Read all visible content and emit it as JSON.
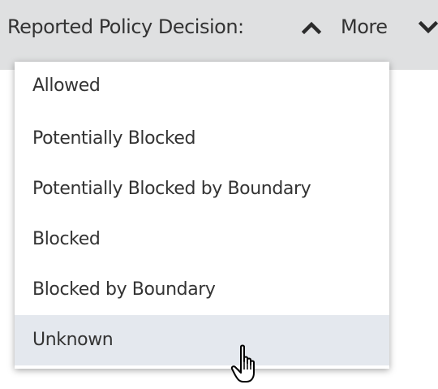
{
  "filter_bar": {
    "label": "Reported Policy Decision:",
    "collapse_icon": "chevron-up-icon",
    "more_label": "More",
    "more_icon": "chevron-down-icon"
  },
  "dropdown": {
    "options": [
      {
        "label": "Allowed"
      },
      {
        "label": "Potentially Blocked"
      },
      {
        "label": "Potentially Blocked by Boundary"
      },
      {
        "label": "Blocked"
      },
      {
        "label": "Blocked by Boundary"
      },
      {
        "label": "Unknown"
      }
    ],
    "hovered_option": "Unknown"
  },
  "cursor": {
    "icon": "hand-pointer-icon"
  },
  "colors": {
    "bar_background": "#dfe0e1",
    "text": "#333333",
    "hover_background": "#e4e8ee"
  }
}
